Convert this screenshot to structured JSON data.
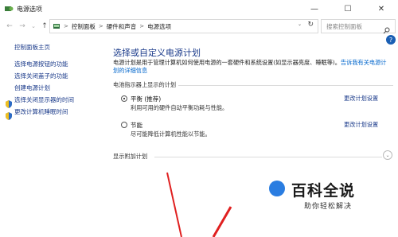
{
  "window": {
    "title": "电源选项",
    "controls": {
      "minimize": "—",
      "maximize": "☐",
      "close": "✕"
    }
  },
  "nav": {
    "back": "←",
    "forward": "→",
    "up": "↑",
    "dropdown": "⌄"
  },
  "address": {
    "segments": [
      "控制面板",
      "硬件和声音",
      "电源选项"
    ],
    "separator": ">",
    "refresh": "↻"
  },
  "search": {
    "placeholder": "搜索控制面板"
  },
  "sidebar": {
    "home": "控制面板主页",
    "items": [
      {
        "label": "选择电源按钮的功能"
      },
      {
        "label": "选择关闭盖子的功能"
      },
      {
        "label": "创建电源计划"
      },
      {
        "label": "选择关闭显示器的时间"
      },
      {
        "label": "更改计算机睡眠时间"
      }
    ]
  },
  "main": {
    "heading": "选择或自定义电源计划",
    "description": "电源计划是用于管理计算机如何使用电源的一套硬件和系统设置(如显示器亮度、睡眠等)。",
    "link": "告诉我有关电源计划的详细信息",
    "section_label": "电池指示器上显示的计划",
    "plans": [
      {
        "name": "平衡 (推荐)",
        "desc": "利用可用的硬件自动平衡功耗与性能。",
        "link": "更改计划设置",
        "selected": true
      },
      {
        "name": "节能",
        "desc": "尽可能降低计算机性能以节能。",
        "link": "更改计划设置",
        "selected": false
      }
    ],
    "more_label": "显示附加计划",
    "more_toggle": "⌄"
  },
  "help": "?",
  "watermark": {
    "title": "百科全说",
    "subtitle": "助你轻松解决"
  },
  "colors": {
    "link": "#1a3a8a",
    "arrow": "#e02020",
    "help": "#1a5fb4"
  }
}
